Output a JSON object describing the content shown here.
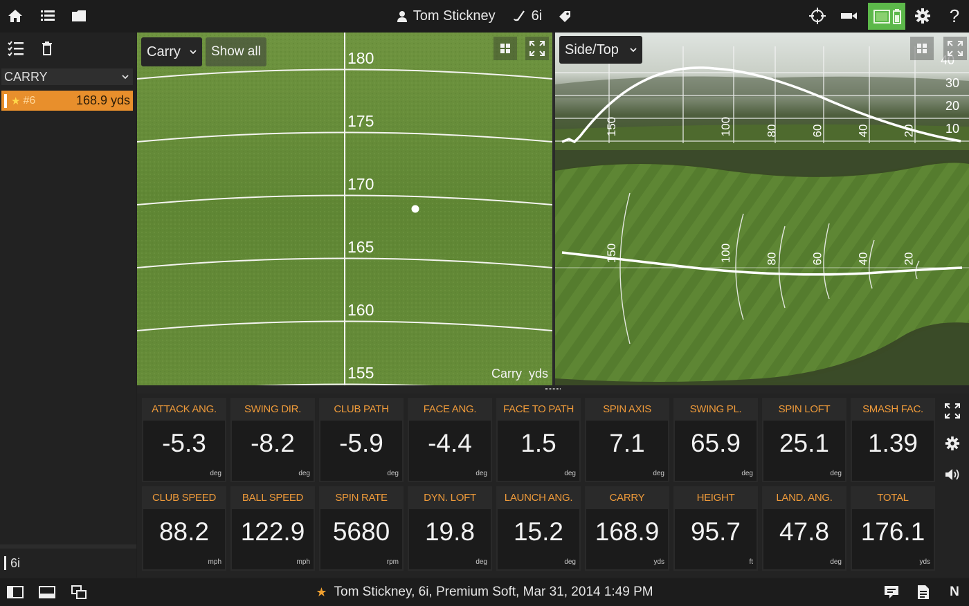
{
  "header": {
    "player": "Tom Stickney",
    "club": "6i"
  },
  "sidebar": {
    "metric_dropdown": "CARRY",
    "shots": [
      {
        "number": "#6",
        "value": "168.9 yds",
        "selected": true,
        "favorite": true
      }
    ],
    "footer_club": "6i"
  },
  "carry_view": {
    "mode": "Carry",
    "show_all_label": "Show all",
    "axis_caption": "Carry  yds",
    "distance_labels": [
      "180",
      "175",
      "170",
      "165",
      "160",
      "155"
    ]
  },
  "side_view": {
    "mode": "Side/Top",
    "height_labels": [
      "40",
      "30",
      "20",
      "10"
    ],
    "distance_labels": [
      "150",
      "100",
      "80",
      "60",
      "40",
      "20"
    ]
  },
  "top_view": {
    "distance_labels": [
      "150",
      "100",
      "80",
      "60",
      "40",
      "20"
    ]
  },
  "tiles": [
    {
      "label": "ATTACK ANG.",
      "value": "-5.3",
      "unit": "deg"
    },
    {
      "label": "SWING DIR.",
      "value": "-8.2",
      "unit": "deg"
    },
    {
      "label": "CLUB PATH",
      "value": "-5.9",
      "unit": "deg"
    },
    {
      "label": "FACE ANG.",
      "value": "-4.4",
      "unit": "deg"
    },
    {
      "label": "FACE TO PATH",
      "value": "1.5",
      "unit": "deg"
    },
    {
      "label": "SPIN AXIS",
      "value": "7.1",
      "unit": "deg"
    },
    {
      "label": "SWING PL.",
      "value": "65.9",
      "unit": "deg"
    },
    {
      "label": "SPIN LOFT",
      "value": "25.1",
      "unit": "deg"
    },
    {
      "label": "SMASH FAC.",
      "value": "1.39",
      "unit": ""
    },
    {
      "label": "CLUB SPEED",
      "value": "88.2",
      "unit": "mph"
    },
    {
      "label": "BALL SPEED",
      "value": "122.9",
      "unit": "mph"
    },
    {
      "label": "SPIN RATE",
      "value": "5680",
      "unit": "rpm"
    },
    {
      "label": "DYN. LOFT",
      "value": "19.8",
      "unit": "deg"
    },
    {
      "label": "LAUNCH ANG.",
      "value": "15.2",
      "unit": "deg"
    },
    {
      "label": "CARRY",
      "value": "168.9",
      "unit": "yds"
    },
    {
      "label": "HEIGHT",
      "value": "95.7",
      "unit": "ft"
    },
    {
      "label": "LAND. ANG.",
      "value": "47.8",
      "unit": "deg"
    },
    {
      "label": "TOTAL",
      "value": "176.1",
      "unit": "yds"
    }
  ],
  "status": {
    "session": "Tom Stickney, 6i, Premium Soft, Mar 31, 2014 1:49 PM",
    "right_letter": "N"
  },
  "colors": {
    "accent": "#ee9a3a",
    "selected_shot": "#e88f2c",
    "active_toggle": "#5cb84a"
  }
}
